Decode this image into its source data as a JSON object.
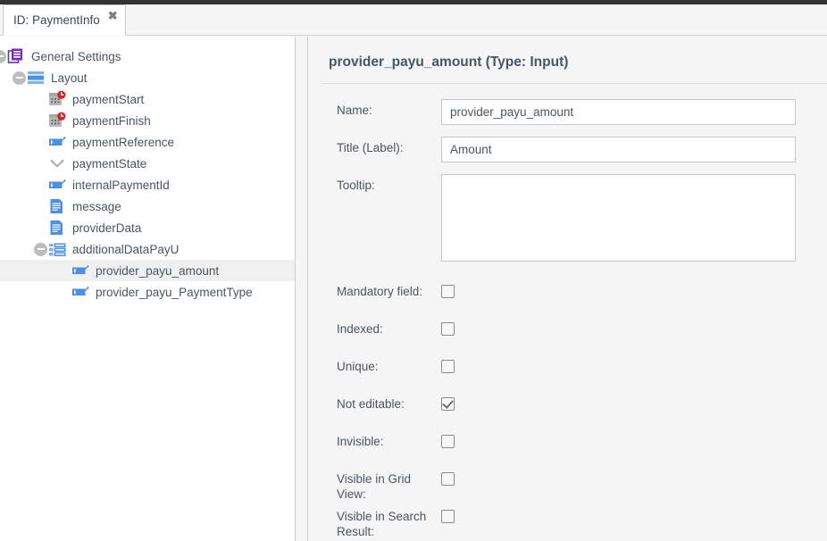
{
  "window": {
    "tab": {
      "label": "ID: PaymentInfo",
      "close_icon": "close-icon"
    }
  },
  "tree": {
    "nodes": [
      {
        "label": "General Settings",
        "icon": "settings-document-icon",
        "depth": 0,
        "toggle": "collapse-minus",
        "selected": false
      },
      {
        "label": "Layout",
        "icon": "layout-icon",
        "depth": 1,
        "toggle": "collapse-minus",
        "selected": false
      },
      {
        "label": "paymentStart",
        "icon": "datetime-icon",
        "depth": 2,
        "toggle": "",
        "selected": false
      },
      {
        "label": "paymentFinish",
        "icon": "datetime-icon",
        "depth": 2,
        "toggle": "",
        "selected": false
      },
      {
        "label": "paymentReference",
        "icon": "input-icon",
        "depth": 2,
        "toggle": "",
        "selected": false
      },
      {
        "label": "paymentState",
        "icon": "chevron-down-icon",
        "depth": 2,
        "toggle": "",
        "selected": false
      },
      {
        "label": "internalPaymentId",
        "icon": "input-icon",
        "depth": 2,
        "toggle": "",
        "selected": false
      },
      {
        "label": "message",
        "icon": "textarea-icon",
        "depth": 2,
        "toggle": "",
        "selected": false
      },
      {
        "label": "providerData",
        "icon": "textarea-icon",
        "depth": 2,
        "toggle": "",
        "selected": false
      },
      {
        "label": "additionalDataPayU",
        "icon": "fieldset-icon",
        "depth": 2,
        "toggle": "collapse-minus",
        "selected": false
      },
      {
        "label": "provider_payu_amount",
        "icon": "input-icon",
        "depth": 3,
        "toggle": "",
        "selected": true
      },
      {
        "label": "provider_payu_PaymentType",
        "icon": "input-icon",
        "depth": 3,
        "toggle": "",
        "selected": false
      }
    ]
  },
  "detail": {
    "title": "provider_payu_amount (Type: Input)",
    "fields": [
      {
        "label": "Name:",
        "value": "provider_payu_amount",
        "placeholder": ""
      },
      {
        "label": "Title (Label):",
        "value": "Amount",
        "placeholder": ""
      }
    ],
    "tooltip": {
      "label": "Tooltip:",
      "value": "",
      "placeholder": ""
    },
    "checkboxes": [
      {
        "label": "Mandatory field:",
        "checked": false
      },
      {
        "label": "Indexed:",
        "checked": false
      },
      {
        "label": "Unique:",
        "checked": false
      },
      {
        "label": "Not editable:",
        "checked": true
      },
      {
        "label": "Invisible:",
        "checked": false
      },
      {
        "label": "Visible in Grid View:",
        "checked": false
      },
      {
        "label": "Visible in Search Result:",
        "checked": false
      }
    ]
  },
  "colors": {
    "accent_purple": "#7B2CBF",
    "accent_blue": "#5599ec",
    "badge_red": "#e02020",
    "text": "#4a5560",
    "panel_bg": "#f5f5f5",
    "selected_row": "#f0f0f0"
  }
}
